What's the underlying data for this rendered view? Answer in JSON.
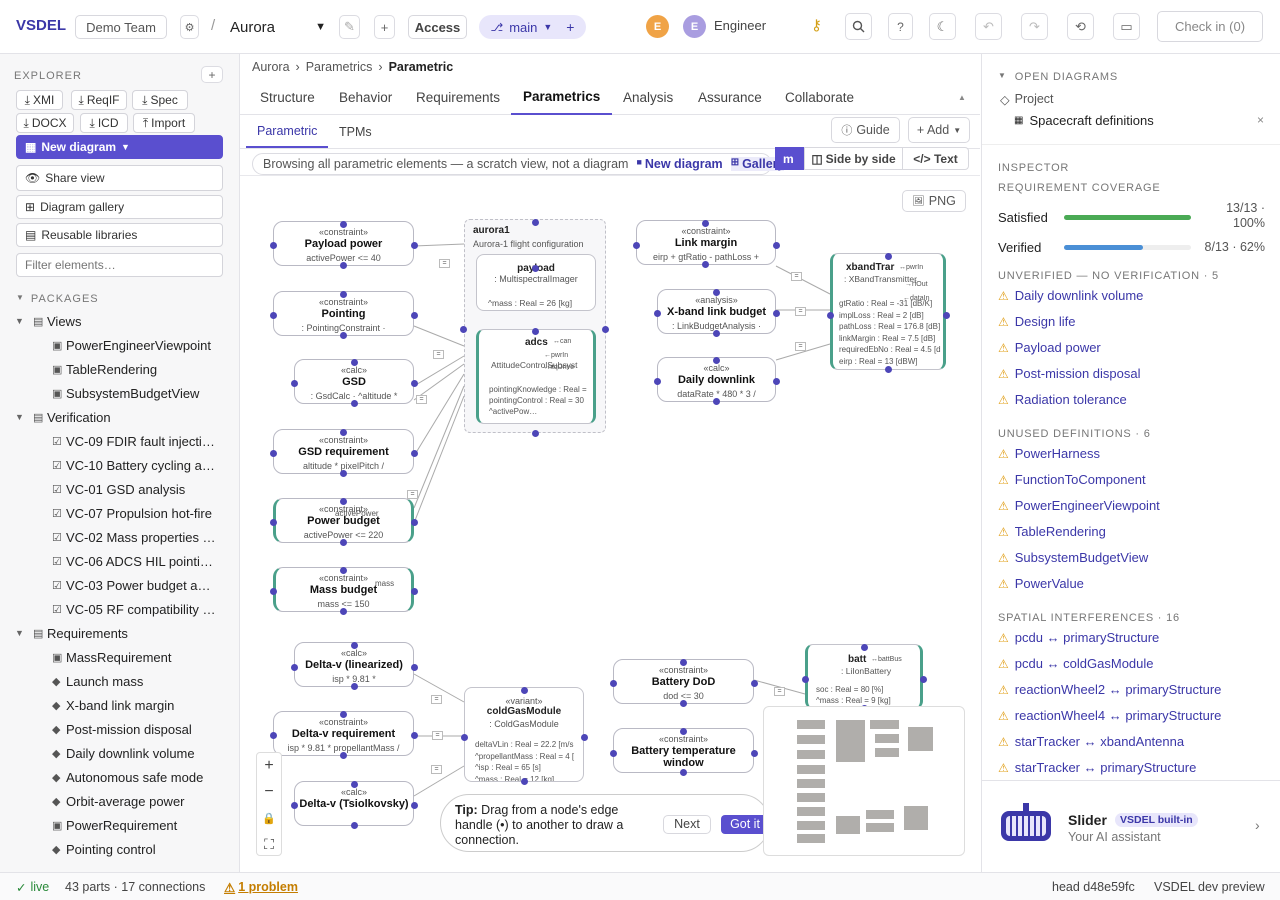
{
  "app": {
    "brand": "VSDEL",
    "team": "Demo Team",
    "project": "Aurora",
    "access_label": "Access",
    "branch": "main",
    "user_initial": "E",
    "user_initial2": "E",
    "user_role": "Engineer",
    "checkin": "Check in (0)",
    "colors": {
      "accent": "#5a4fcf",
      "brand": "#3b37a8"
    }
  },
  "explorer": {
    "title": "EXPLORER",
    "imports": [
      "XMI",
      "ReqIF",
      "Spec",
      "DOCX",
      "ICD",
      "Import"
    ],
    "new_diagram": "New diagram",
    "share_view": "Share view",
    "gallery": "Diagram gallery",
    "libraries": "Reusable libraries",
    "filter_placeholder": "Filter elements…",
    "packages_title": "PACKAGES",
    "tree": [
      {
        "label": "Views",
        "level": 0,
        "icon": "package"
      },
      {
        "label": "PowerEngineerViewpoint",
        "level": 1,
        "icon": "diagram"
      },
      {
        "label": "TableRendering",
        "level": 1,
        "icon": "diagram"
      },
      {
        "label": "SubsystemBudgetView",
        "level": 1,
        "icon": "diagram"
      },
      {
        "label": "Verification",
        "level": 0,
        "icon": "package"
      },
      {
        "label": "VC-09 FDIR fault injecti…",
        "level": 1,
        "icon": "check"
      },
      {
        "label": "VC-10 Battery cycling a…",
        "level": 1,
        "icon": "check"
      },
      {
        "label": "VC-01 GSD analysis",
        "level": 1,
        "icon": "check"
      },
      {
        "label": "VC-07 Propulsion hot-fire",
        "level": 1,
        "icon": "check"
      },
      {
        "label": "VC-02 Mass properties …",
        "level": 1,
        "icon": "check"
      },
      {
        "label": "VC-06 ADCS HIL pointi…",
        "level": 1,
        "icon": "check"
      },
      {
        "label": "VC-03 Power budget a…",
        "level": 1,
        "icon": "check"
      },
      {
        "label": "VC-05 RF compatibility …",
        "level": 1,
        "icon": "check"
      },
      {
        "label": "Requirements",
        "level": 0,
        "icon": "package"
      },
      {
        "label": "MassRequirement",
        "level": 1,
        "icon": "diagram"
      },
      {
        "label": "Launch mass",
        "level": 1,
        "icon": "diamond"
      },
      {
        "label": "X-band link margin",
        "level": 1,
        "icon": "diamond"
      },
      {
        "label": "Post-mission disposal",
        "level": 1,
        "icon": "diamond"
      },
      {
        "label": "Daily downlink volume",
        "level": 1,
        "icon": "diamond"
      },
      {
        "label": "Autonomous safe mode",
        "level": 1,
        "icon": "diamond"
      },
      {
        "label": "Orbit-average power",
        "level": 1,
        "icon": "diamond"
      },
      {
        "label": "PowerRequirement",
        "level": 1,
        "icon": "diagram"
      },
      {
        "label": "Pointing control",
        "level": 1,
        "icon": "diamond"
      }
    ]
  },
  "center": {
    "breadcrumb": [
      "Aurora",
      "Parametrics",
      "Parametric"
    ],
    "tabs": [
      "Structure",
      "Behavior",
      "Requirements",
      "Parametrics",
      "Analysis",
      "Assurance",
      "Collaborate"
    ],
    "active_tab": "Parametrics",
    "subtabs": [
      "Parametric",
      "TPMs"
    ],
    "guide": "Guide",
    "add": "+ Add",
    "banner": "Browsing all parametric elements — a scratch view, not a diagram",
    "banner_new": "New diagram",
    "banner_gallery": "Gallery",
    "view_modes": [
      "m",
      "Side by side",
      "</> Text"
    ],
    "png": "PNG",
    "tip_bold": "Tip:",
    "tip_text": "Drag from a node's edge handle (•) to another to draw a connection.",
    "tip_next": "Next",
    "tip_got": "Got it",
    "nodes": {
      "payload_power": {
        "st": "«constraint»",
        "nm": "Payload power",
        "ex": "activePower <= 40"
      },
      "pointing": {
        "st": "«constraint»",
        "nm": "Pointing",
        "ex": ": PointingConstraint ·"
      },
      "gsd": {
        "st": "«calc»",
        "nm": "GSD",
        "ex": ": GsdCalc · ^altitude *"
      },
      "gsd_req": {
        "st": "«constraint»",
        "nm": "GSD requirement",
        "ex": "altitude * pixelPitch /"
      },
      "power_budget": {
        "st": "«constraint»",
        "nm": "Power budget",
        "ex": "activePower <= 220",
        "port": "activePower"
      },
      "mass_budget": {
        "st": "«constraint»",
        "nm": "Mass budget",
        "ex": "mass <= 150",
        "port": "mass"
      },
      "aurora1": {
        "nm": "aurora1",
        "ex": "Aurora-1 flight configuration"
      },
      "payload": {
        "nm": "payload",
        "ex": ": MultispectralImager",
        "attr": "^mass : Real = 26 [kg]"
      },
      "adcs": {
        "nm": "adcs",
        "ex": "AttitudeControlSubsyst",
        "attrs": [
          "pointingKnowledge : Real =",
          "pointingControl : Real = 30",
          "^activePow…"
        ],
        "ports": [
          "↔can",
          "←pwrIn",
          "→ntqDrive"
        ]
      },
      "link_margin": {
        "st": "«constraint»",
        "nm": "Link margin",
        "ex": "eirp + gtRatio - pathLoss +"
      },
      "xband_budget": {
        "st": "«analysis»",
        "nm": "X-band link budget",
        "ex": ": LinkBudgetAnalysis ·"
      },
      "daily_downlink": {
        "st": "«calc»",
        "nm": "Daily downlink",
        "ex": "dataRate * 480 * 3 /"
      },
      "xband": {
        "nm": "xbandTrar",
        "ex": ": XBandTransmitter",
        "ports": [
          "↔pwrIn",
          "→rfOut",
          "←dataIn"
        ],
        "attrs": [
          "gtRatio : Real = -31 [dB/K]",
          "implLoss : Real = 2 [dB]",
          "pathLoss : Real = 176.8 [dB]",
          "linkMargin : Real = 7.5 [dB]",
          "requiredEbNo : Real = 4.5 [d",
          "eirp : Real = 13 [dBW]"
        ]
      },
      "dv_lin": {
        "st": "«calc»",
        "nm": "Delta-v (linearized)",
        "ex": "isp * 9.81 *"
      },
      "dv_req": {
        "st": "«constraint»",
        "nm": "Delta-v requirement",
        "ex": "isp * 9.81 * propellantMass /"
      },
      "dv_tsiol": {
        "st": "«calc»",
        "nm": "Delta-v (Tsiolkovsky)",
        "ex": ""
      },
      "cold_gas": {
        "st": "«variant»",
        "nm": "coldGasModule",
        "ex": ": ColdGasModule",
        "attrs": [
          "deltaVLin : Real = 22.2 [m/s",
          "^propellantMass : Real = 4 [",
          "^isp : Real = 65 [s]",
          "^mass : Real = 12 [kg]"
        ]
      },
      "battery_dod": {
        "st": "«constraint»",
        "nm": "Battery DoD",
        "ex": "dod <= 30"
      },
      "battery_temp": {
        "st": "«constraint»",
        "nm": "Battery temperature window",
        "ex": ""
      },
      "batt": {
        "nm": "batt",
        "ex": ": LiIonBattery",
        "port": "↔battBus",
        "attrs": [
          "soc : Real = 80 [%]",
          "^mass : Real = 9 [kg]"
        ]
      }
    }
  },
  "inspector": {
    "open_title": "OPEN DIAGRAMS",
    "project": "Project",
    "diagram": "Spacecraft definitions",
    "inspector_title": "INSPECTOR",
    "coverage_title": "REQUIREMENT COVERAGE",
    "satisfied_label": "Satisfied",
    "satisfied_value": "13/13 · 100%",
    "satisfied_fraction": 1.0,
    "verified_label": "Verified",
    "verified_value": "8/13 · 62%",
    "verified_fraction": 0.62,
    "unverified_title": "UNVERIFIED — NO VERIFICATION · 5",
    "unverified": [
      "Daily downlink volume",
      "Design life",
      "Payload power",
      "Post-mission disposal",
      "Radiation tolerance"
    ],
    "unused_title": "UNUSED DEFINITIONS · 6",
    "unused": [
      "PowerHarness",
      "FunctionToComponent",
      "PowerEngineerViewpoint",
      "TableRendering",
      "SubsystemBudgetView",
      "PowerValue"
    ],
    "spatial_title": "SPATIAL INTERFERENCES · 16",
    "spatial": [
      "pcdu ↔ primaryStructure",
      "pcdu ↔ coldGasModule",
      "reactionWheel2 ↔ primaryStructure",
      "reactionWheel4 ↔ primaryStructure",
      "starTracker ↔ xbandAntenna",
      "starTracker ↔ primaryStructure"
    ],
    "assistant_name": "Slider",
    "assistant_badge": "VSDEL built-in",
    "assistant_sub": "Your AI assistant"
  },
  "status": {
    "live": "live",
    "counts": "43 parts · 17 connections",
    "problem": "1 problem",
    "head": "head d48e59fc",
    "env": "VSDEL dev preview"
  }
}
